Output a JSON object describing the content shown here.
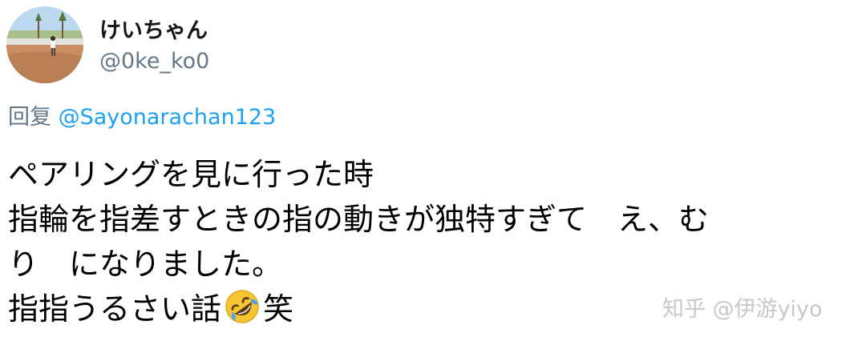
{
  "author": {
    "display_name": "けいちゃん",
    "handle": "@0ke_ko0"
  },
  "reply": {
    "prefix": "回复",
    "mention": "@Sayonarachan123"
  },
  "tweet": {
    "line1": "ペアリングを見に行った時",
    "line2": "指輪を指差すときの指の動きが独特すぎて　え、む",
    "line3": "り　になりました。",
    "line4_before_emoji": "指指うるさい話",
    "emoji": "rolling-on-floor-laughing-emoji",
    "line4_after_emoji": "笑"
  },
  "watermark": {
    "text": "知乎 @伊游yiyo"
  }
}
